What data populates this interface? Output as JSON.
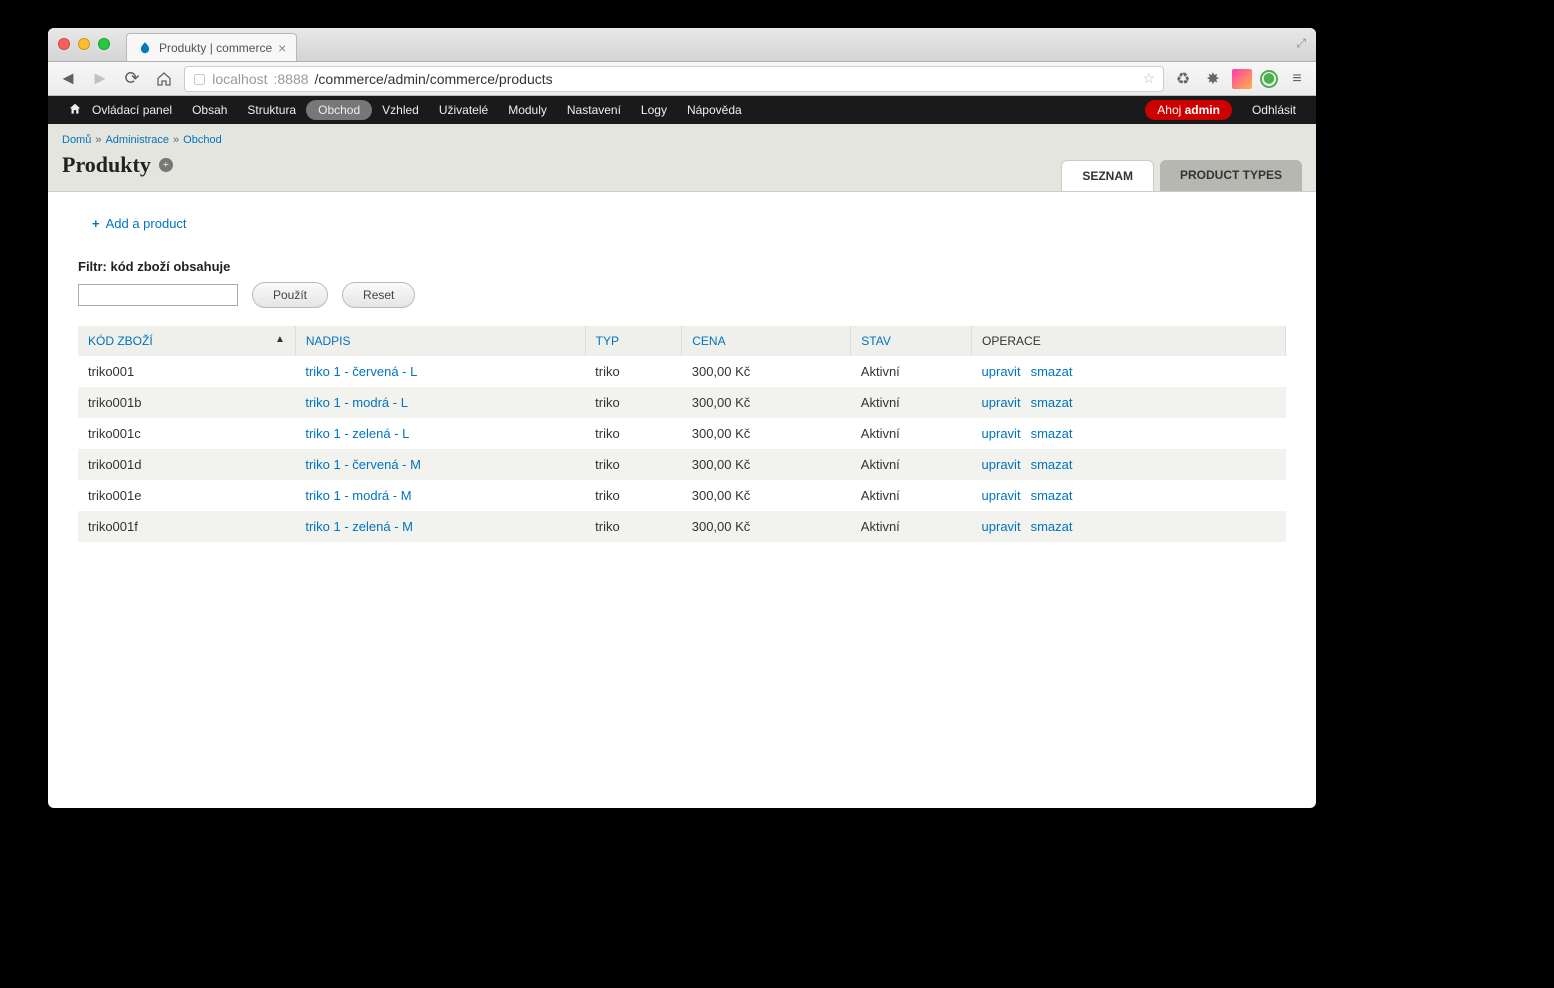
{
  "browser": {
    "tab_title": "Produkty | commerce",
    "url_host_dim1": "localhost",
    "url_port": ":8888",
    "url_path": "/commerce/admin/commerce/products"
  },
  "admin_menu": {
    "items": [
      "Ovládací panel",
      "Obsah",
      "Struktura",
      "Obchod",
      "Vzhled",
      "Uživatelé",
      "Moduly",
      "Nastavení",
      "Logy",
      "Nápověda"
    ],
    "active_index": 3,
    "hello_prefix": "Ahoj ",
    "hello_user": "admin",
    "logout": "Odhlásit"
  },
  "breadcrumb": {
    "items": [
      "Domů",
      "Administrace",
      "Obchod"
    ]
  },
  "page": {
    "title": "Produkty",
    "tabs": [
      "SEZNAM",
      "PRODUCT TYPES"
    ],
    "active_tab": 0,
    "add_link": "Add a product"
  },
  "filter": {
    "label": "Filtr: kód zboží obsahuje",
    "apply": "Použít",
    "reset": "Reset"
  },
  "table": {
    "headers": {
      "sku": "KÓD ZBOŽÍ",
      "title": "NADPIS",
      "type": "TYP",
      "price": "CENA",
      "status": "STAV",
      "ops": "OPERACE"
    },
    "op_edit": "upravit",
    "op_delete": "smazat",
    "rows": [
      {
        "sku": "triko001",
        "title": "triko 1 - červená - L",
        "type": "triko",
        "price": "300,00 Kč",
        "status": "Aktivní"
      },
      {
        "sku": "triko001b",
        "title": "triko 1 - modrá - L",
        "type": "triko",
        "price": "300,00 Kč",
        "status": "Aktivní"
      },
      {
        "sku": "triko001c",
        "title": "triko 1 - zelená - L",
        "type": "triko",
        "price": "300,00 Kč",
        "status": "Aktivní"
      },
      {
        "sku": "triko001d",
        "title": "triko 1 - červená - M",
        "type": "triko",
        "price": "300,00 Kč",
        "status": "Aktivní"
      },
      {
        "sku": "triko001e",
        "title": "triko 1 - modrá - M",
        "type": "triko",
        "price": "300,00 Kč",
        "status": "Aktivní"
      },
      {
        "sku": "triko001f",
        "title": "triko 1 - zelená - M",
        "type": "triko",
        "price": "300,00 Kč",
        "status": "Aktivní"
      }
    ]
  }
}
